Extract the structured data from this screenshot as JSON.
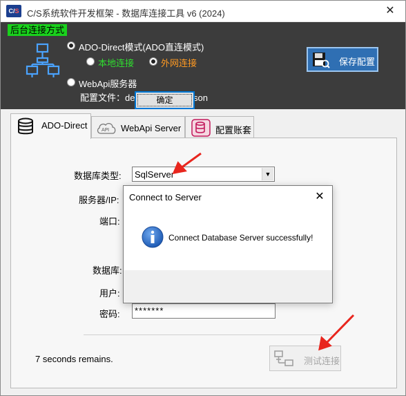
{
  "window": {
    "title": "C/S系统软件开发框架 - 数据库连接工具 v6 (2024)",
    "app_icon_text": "C/S",
    "close_glyph": "✕"
  },
  "connection_mode": {
    "group_label": "后台连接方式",
    "ado_direct": {
      "label": "ADO-Direct模式(ADO直连模式)",
      "checked": true
    },
    "local": {
      "label": "本地连接",
      "checked": false
    },
    "internet": {
      "label": "外网连接",
      "checked": true
    },
    "webapi": {
      "label": "WebApi服务器",
      "checked": false
    },
    "config_file": "配置文件：debug\\config\\db.json",
    "network_icon": "network-topology-icon"
  },
  "save_button": {
    "label": "保存配置",
    "icon": "save-config-icon"
  },
  "tabs": [
    {
      "label": "ADO-Direct",
      "icon": "database-icon",
      "active": true
    },
    {
      "label": "WebApi Server",
      "icon": "api-cloud-icon",
      "active": false
    },
    {
      "label": "配置账套",
      "icon": "database-settings-icon",
      "active": false
    }
  ],
  "form": {
    "db_type_label": "数据库类型:",
    "db_type_value": "SqlServer",
    "server_label": "服务器/IP:",
    "port_label": "端口:",
    "database_label": "数据库:",
    "user_label": "用户:",
    "password_label": "密码:",
    "password_value": "*******"
  },
  "test_button": {
    "label": "测试连接",
    "enabled": false,
    "icon": "test-connection-icon"
  },
  "status_text": "7 seconds remains.",
  "dialog": {
    "title": "Connect to Server",
    "message": "Connect Database Server successfully!",
    "ok_label": "确定",
    "close_glyph": "✕",
    "icon": "info-icon"
  },
  "colors": {
    "header_bg": "#3c3c3c",
    "group_tag": "#19d21c",
    "save_button": "#2f6fb3",
    "annotation_arrow": "#e8261e",
    "info_icon": "#1e5bb5"
  }
}
